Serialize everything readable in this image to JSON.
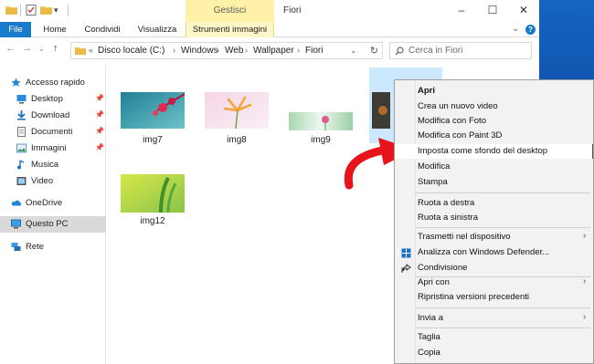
{
  "window": {
    "title": "Fiori",
    "context_tab_group": "Gestisci"
  },
  "ribbon": {
    "tabs": [
      "File",
      "Home",
      "Condividi",
      "Visualizza",
      "Strumenti immagini"
    ]
  },
  "address": {
    "breadcrumbs": [
      "Disco locale (C:)",
      "Windows",
      "Web",
      "Wallpaper",
      "Fiori"
    ],
    "search_placeholder": "Cerca in Fiori"
  },
  "nav": {
    "items": [
      {
        "label": "Accesso rapido",
        "icon": "star-icon",
        "pinned": false
      },
      {
        "label": "Desktop",
        "icon": "desktop-icon",
        "pinned": true
      },
      {
        "label": "Download",
        "icon": "download-icon",
        "pinned": true
      },
      {
        "label": "Documenti",
        "icon": "documents-icon",
        "pinned": true
      },
      {
        "label": "Immagini",
        "icon": "pictures-icon",
        "pinned": true
      },
      {
        "label": "Musica",
        "icon": "music-icon",
        "pinned": false
      },
      {
        "label": "Video",
        "icon": "video-icon",
        "pinned": false
      },
      {
        "label": "OneDrive",
        "icon": "onedrive-icon",
        "pinned": false
      },
      {
        "label": "Questo PC",
        "icon": "pc-icon",
        "pinned": false,
        "selected": true
      },
      {
        "label": "Rete",
        "icon": "network-icon",
        "pinned": false
      }
    ]
  },
  "files": [
    {
      "name": "img7"
    },
    {
      "name": "img8"
    },
    {
      "name": "img9"
    },
    {
      "name": "img12"
    }
  ],
  "context_menu": {
    "items": [
      {
        "label": "Apri",
        "bold": true
      },
      {
        "label": "Crea un nuovo video"
      },
      {
        "label": "Modifica con Foto"
      },
      {
        "label": "Modifica con Paint 3D"
      },
      {
        "label": "Imposta come sfondo del desktop",
        "highlighted": true
      },
      {
        "label": "Modifica"
      },
      {
        "label": "Stampa"
      },
      {
        "label": "Ruota a destra"
      },
      {
        "label": "Ruota a sinistra"
      },
      {
        "label": "Trasmetti nel dispositivo",
        "submenu": true
      },
      {
        "label": "Analizza con Windows Defender...",
        "icon": "defender-icon"
      },
      {
        "label": "Condivisione",
        "icon": "share-icon"
      },
      {
        "label": "Apri con",
        "submenu": true
      },
      {
        "label": "Ripristina versioni precedenti"
      },
      {
        "label": "Invia a",
        "submenu": true
      },
      {
        "label": "Taglia"
      },
      {
        "label": "Copia"
      }
    ]
  },
  "colors": {
    "file_tab": "#1979ca",
    "context_tab": "#fff2a8",
    "selection": "#cce8ff",
    "annotation_arrow": "#e8141b"
  }
}
